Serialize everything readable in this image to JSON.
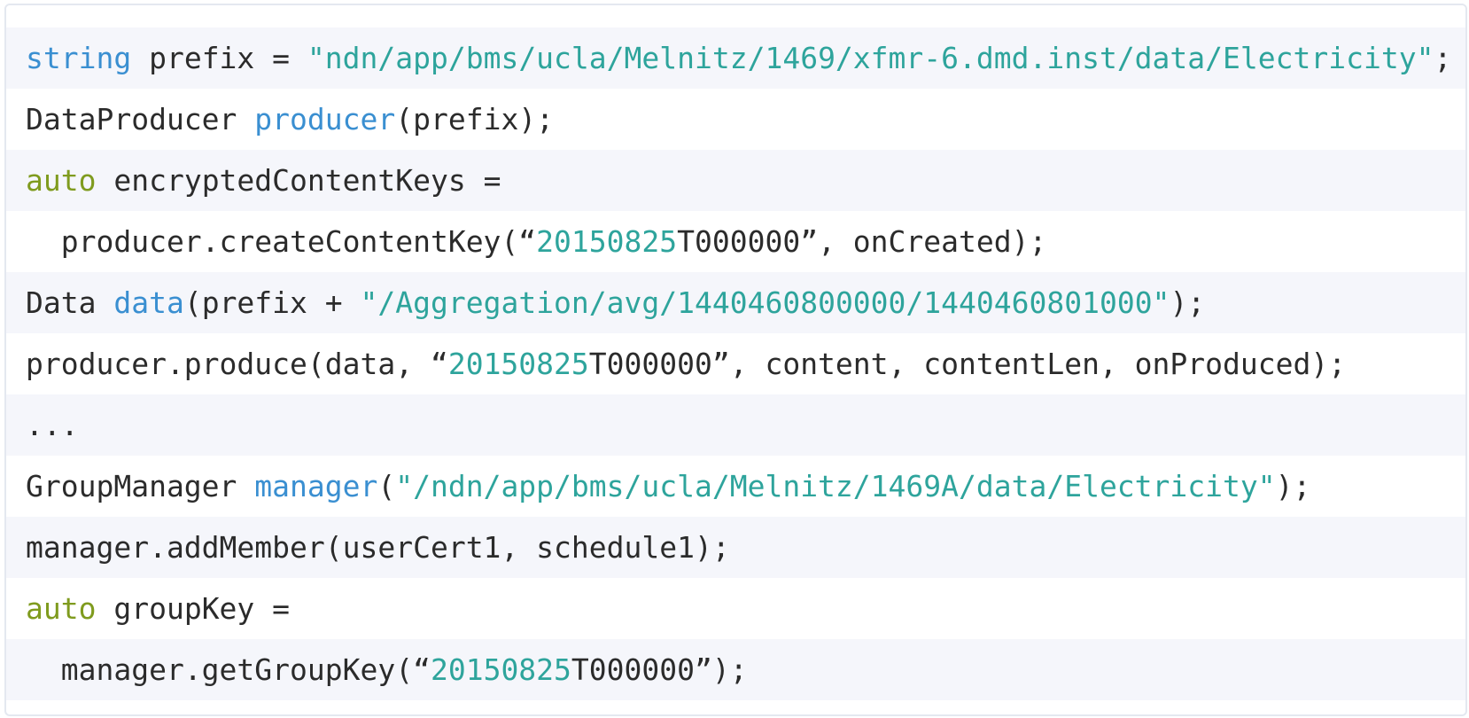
{
  "theme": {
    "background": "#ffffff",
    "border": "#e4e8f0",
    "band_shaded": "#f5f6fb",
    "band_plain": "#ffffff",
    "text": "#2b2b2b",
    "type_color": "#3a8fd1",
    "keyword_color": "#7f9b1e",
    "string_color": "#2ea49c"
  },
  "code": {
    "lines": [
      {
        "band": "a",
        "tokens": [
          {
            "kind": "type",
            "text": "string"
          },
          {
            "kind": "plain",
            "text": " prefix = "
          },
          {
            "kind": "str",
            "text": "\"ndn/app/bms/ucla/Melnitz/1469/xfmr-6.dmd.inst/data/Electricity\""
          },
          {
            "kind": "plain",
            "text": ";"
          }
        ]
      },
      {
        "band": "b",
        "tokens": [
          {
            "kind": "plain",
            "text": "DataProducer "
          },
          {
            "kind": "fn",
            "text": "producer"
          },
          {
            "kind": "plain",
            "text": "(prefix);"
          }
        ]
      },
      {
        "band": "a",
        "tokens": [
          {
            "kind": "kw",
            "text": "auto"
          },
          {
            "kind": "plain",
            "text": " encryptedContentKeys ="
          }
        ]
      },
      {
        "band": "b",
        "tokens": [
          {
            "kind": "plain",
            "text": "  producer.createContentKey(“"
          },
          {
            "kind": "num",
            "text": "20150825"
          },
          {
            "kind": "plain",
            "text": "T000000”, onCreated);"
          }
        ]
      },
      {
        "band": "a",
        "tokens": [
          {
            "kind": "plain",
            "text": "Data "
          },
          {
            "kind": "fn",
            "text": "data"
          },
          {
            "kind": "plain",
            "text": "(prefix + "
          },
          {
            "kind": "str",
            "text": "\"/Aggregation/avg/1440460800000/1440460801000\""
          },
          {
            "kind": "plain",
            "text": ");"
          }
        ]
      },
      {
        "band": "b",
        "tokens": [
          {
            "kind": "plain",
            "text": "producer.produce(data, “"
          },
          {
            "kind": "num",
            "text": "20150825"
          },
          {
            "kind": "plain",
            "text": "T000000”, content, contentLen, onProduced);"
          }
        ]
      },
      {
        "band": "a",
        "tokens": [
          {
            "kind": "plain",
            "text": "..."
          }
        ]
      },
      {
        "band": "b",
        "tokens": [
          {
            "kind": "plain",
            "text": "GroupManager "
          },
          {
            "kind": "fn",
            "text": "manager"
          },
          {
            "kind": "plain",
            "text": "("
          },
          {
            "kind": "str",
            "text": "\"/ndn/app/bms/ucla/Melnitz/1469A/data/Electricity\""
          },
          {
            "kind": "plain",
            "text": ");"
          }
        ]
      },
      {
        "band": "a",
        "tokens": [
          {
            "kind": "plain",
            "text": "manager.addMember(userCert1, schedule1);"
          }
        ]
      },
      {
        "band": "b",
        "tokens": [
          {
            "kind": "kw",
            "text": "auto"
          },
          {
            "kind": "plain",
            "text": " groupKey ="
          }
        ]
      },
      {
        "band": "a",
        "tokens": [
          {
            "kind": "plain",
            "text": "  manager.getGroupKey(“"
          },
          {
            "kind": "num",
            "text": "20150825"
          },
          {
            "kind": "plain",
            "text": "T000000”);"
          }
        ]
      }
    ]
  }
}
